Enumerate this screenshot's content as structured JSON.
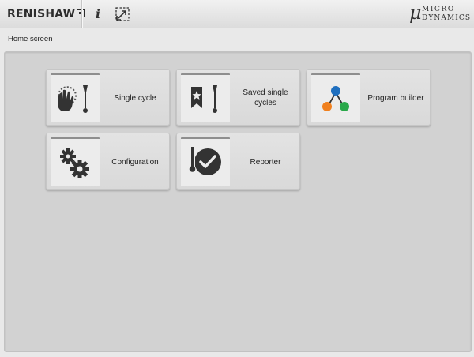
{
  "header": {
    "brand_left": "RENISHAW",
    "info_label": "i",
    "resize_icon": "resize-icon",
    "brand_right_symbol": "μ",
    "brand_right_line1": "MICRO",
    "brand_right_line2": "DYNAMICS"
  },
  "breadcrumb": "Home screen",
  "tiles": [
    {
      "label": "Single cycle",
      "icon": "single-cycle-icon"
    },
    {
      "label": "Saved single cycles",
      "icon": "saved-cycles-icon"
    },
    {
      "label": "Program builder",
      "icon": "program-builder-icon"
    },
    {
      "label": "Configuration",
      "icon": "gears-icon"
    },
    {
      "label": "Reporter",
      "icon": "reporter-icon"
    }
  ],
  "colors": {
    "node_blue": "#1f6fbf",
    "node_orange": "#f0801e",
    "node_green": "#2aa84a",
    "icon_dark": "#333333"
  }
}
